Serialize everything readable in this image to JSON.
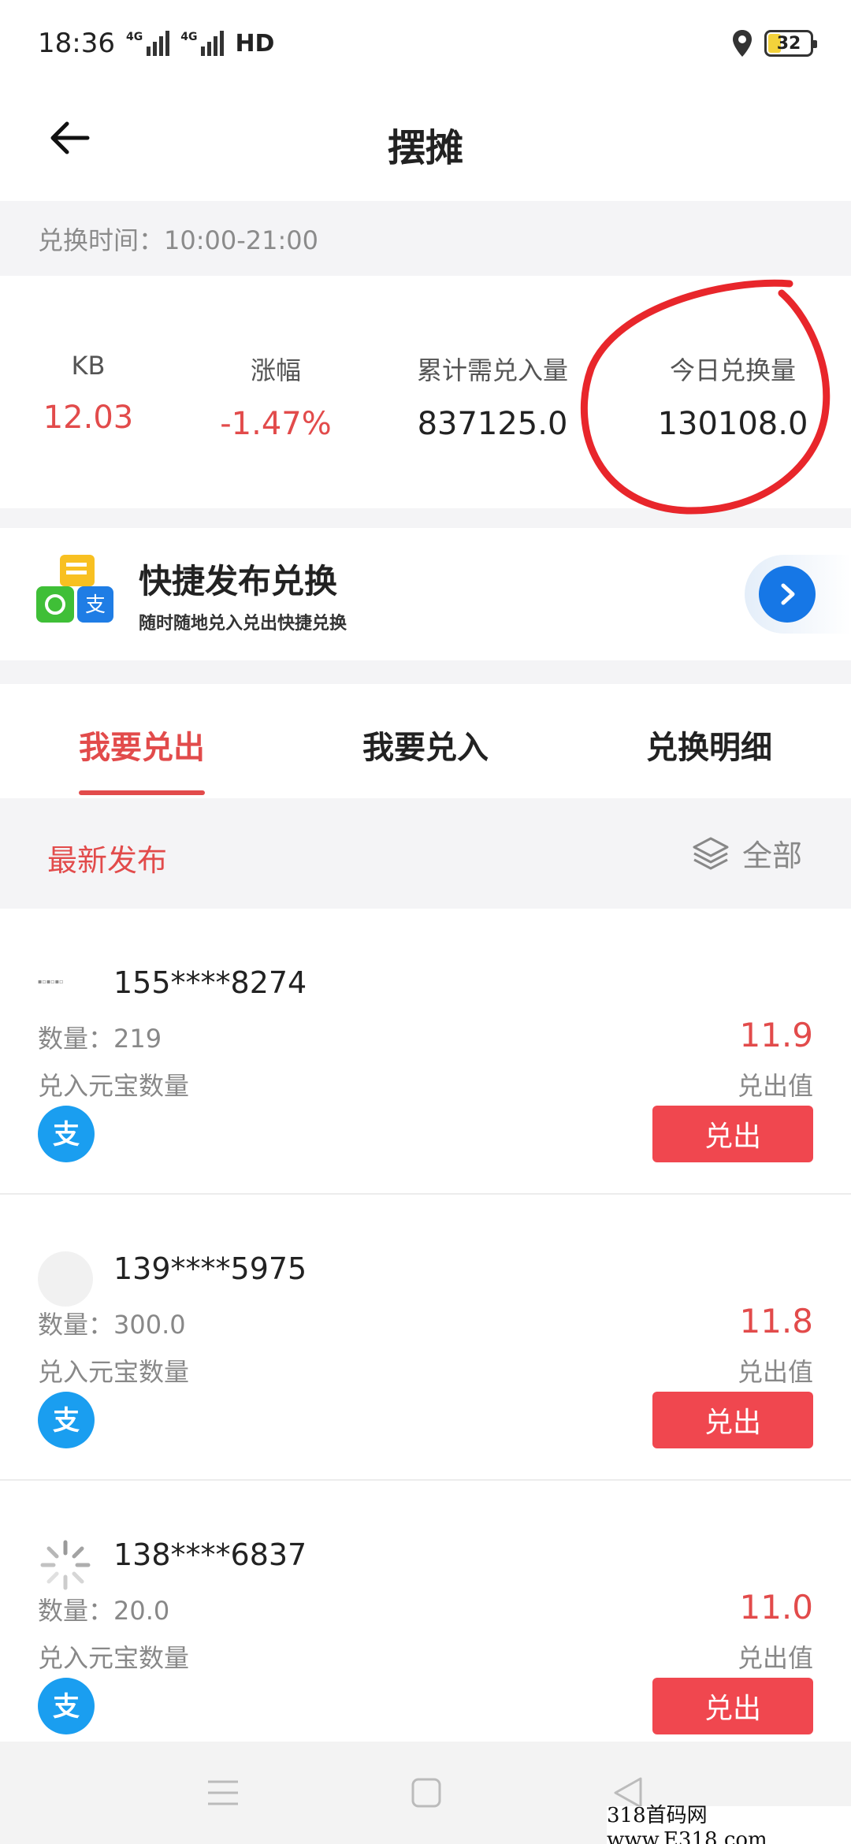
{
  "status": {
    "time": "18:36",
    "net1": "4G",
    "net2": "4G",
    "hd": "HD",
    "battery": "32"
  },
  "nav": {
    "title": "摆摊"
  },
  "exchange_time": "兑换时间：10:00-21:00",
  "stats": [
    {
      "label": "KB",
      "value": "12.03",
      "color": "red"
    },
    {
      "label": "涨幅",
      "value": "-1.47%",
      "color": "red"
    },
    {
      "label": "累计需兑入量",
      "value": "837125.0",
      "color": "dark"
    },
    {
      "label": "今日兑换量",
      "value": "130108.0",
      "color": "dark"
    }
  ],
  "banner": {
    "title": "快捷发布兑换",
    "subtitle": "随时随地兑入兑出快捷兑换"
  },
  "tabs": [
    "我要兑出",
    "我要兑入",
    "兑换明细"
  ],
  "filter": {
    "latest": "最新发布",
    "all": "全部"
  },
  "listings": [
    {
      "phone": "155****8274",
      "qty": "数量：219",
      "qty_label": "兑入元宝数量",
      "price": "11.9",
      "price_label": "兑出值",
      "button": "兑出"
    },
    {
      "phone": "139****5975",
      "qty": "数量：300.0",
      "qty_label": "兑入元宝数量",
      "price": "11.8",
      "price_label": "兑出值",
      "button": "兑出"
    },
    {
      "phone": "138****6837",
      "qty": "数量：20.0",
      "qty_label": "兑入元宝数量",
      "price": "11.0",
      "price_label": "兑出值",
      "button": "兑出"
    }
  ],
  "watermark": "318首码网 www.E318.com",
  "colors": {
    "accent": "#e24b4b",
    "button": "#f0474f",
    "alipay": "#1a9ef0"
  }
}
